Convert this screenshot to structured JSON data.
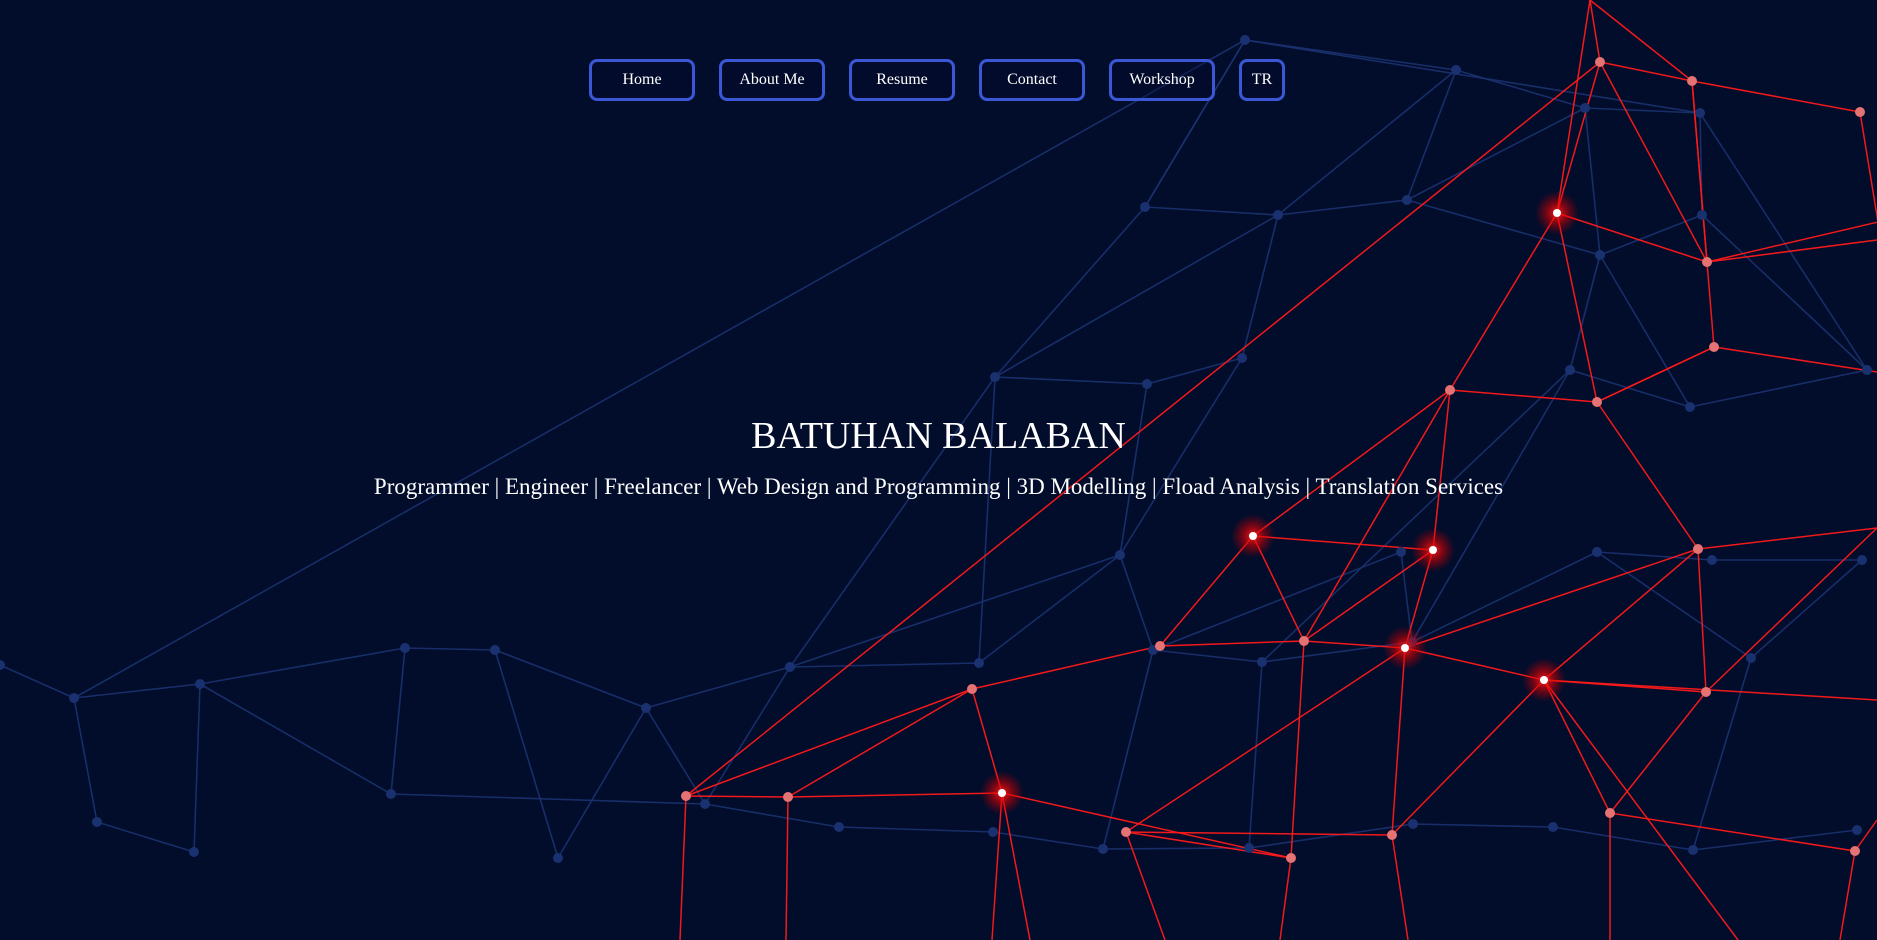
{
  "nav": {
    "items": [
      {
        "label": "Home"
      },
      {
        "label": "About Me"
      },
      {
        "label": "Resume"
      },
      {
        "label": "Contact"
      },
      {
        "label": "Workshop"
      },
      {
        "label": "TR"
      }
    ]
  },
  "hero": {
    "title": "BATUHAN BALABAN",
    "subtitle": "Programmer | Engineer | Freelancer | Web Design and Programming | 3D Modelling | Fload Analysis | Translation Services"
  },
  "background": {
    "description_icon": "particle-network-icon",
    "colors": {
      "page_bg": "#020c2b",
      "nav_border": "#3a57d6",
      "link_blue": "#1b3270",
      "node_blue": "#1a3170",
      "link_red": "#ff1a1a",
      "node_pink": "#e57373",
      "glow_red": "#ff0000"
    }
  }
}
